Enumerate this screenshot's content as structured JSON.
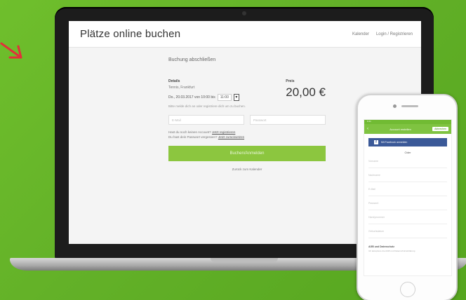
{
  "site": {
    "title": "Plätze online buchen",
    "nav": [
      "Kalender",
      "Login / Registrieren"
    ]
  },
  "booking": {
    "step_title": "Buchung abschließen",
    "details_label": "Details",
    "court": "Tennis, Frankfurt",
    "date_text": "Do., 20.03.2017 von 10:00 bis",
    "duration_value": "11:00",
    "price_label": "Preis",
    "price": "20,00 €",
    "hint": "Bitte melde dich an oder registriere dich um zu buchen.",
    "email_placeholder": "E-Mail",
    "password_placeholder": "Passwort",
    "no_account_text": "Hast du noch keinen Account?",
    "register_link": "Jetzt registrieren",
    "forgot_text": "Du hast dein Passwort vergessen?",
    "reset_link": "Jetzt zurücksetzen",
    "submit_label": "Buchen/Anmelden",
    "back_link": "Zurück zum Kalender"
  },
  "phone": {
    "status": "9:41",
    "title": "Account erstellen",
    "close_label": "Abbrechen",
    "facebook_label": "Mit Facebook anmelden",
    "or_label": "Oder",
    "fields": [
      "Vorname",
      "Nachname",
      "E-Mail",
      "Passwort",
      "Handynummer",
      "Geburtsdatum"
    ],
    "section_title": "AGB und Datenschutz",
    "section_sub": "Ich akzeptiere die AGB und Datenschutzerklärung"
  },
  "colors": {
    "background": "#63b128",
    "accent_green": "#8cc63f",
    "facebook_blue": "#3b5998",
    "arrow_red": "#e2303a"
  }
}
